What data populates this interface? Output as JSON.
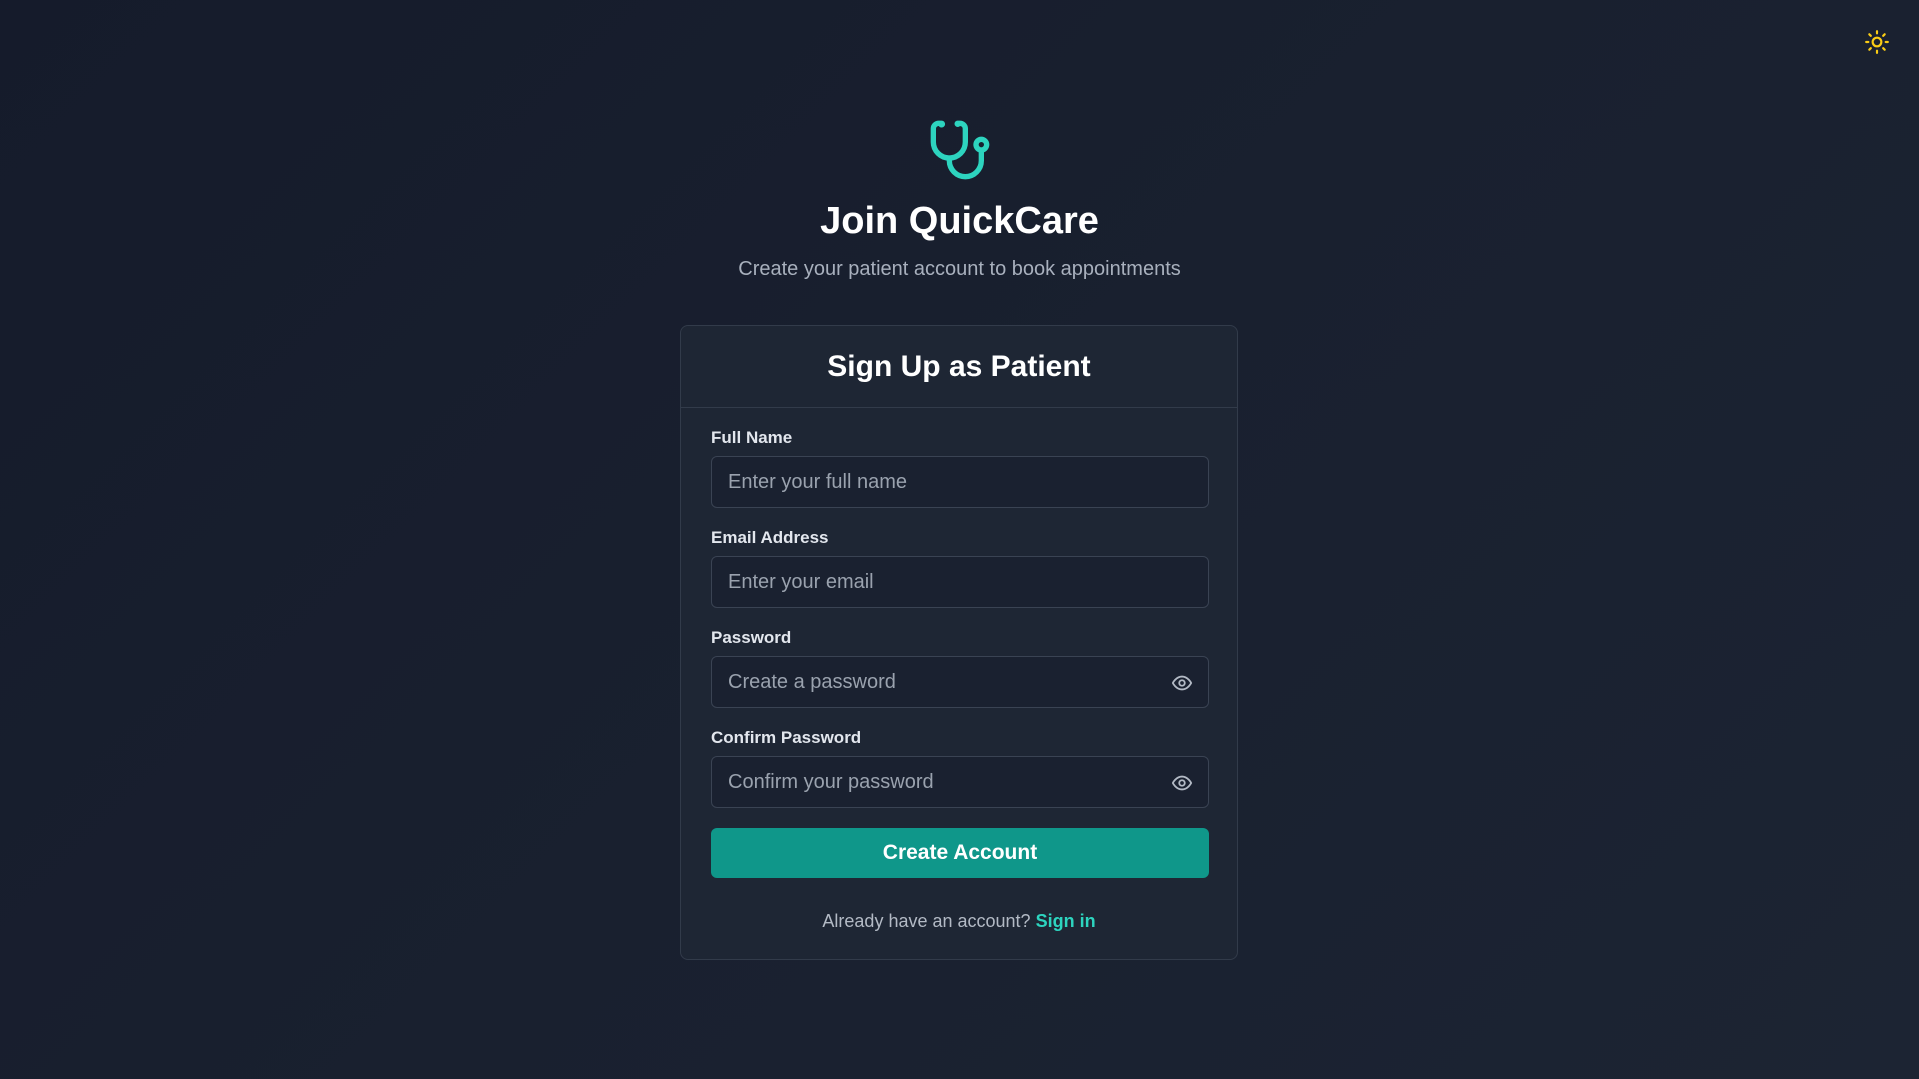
{
  "theme_toggle": {
    "icon": "sun-icon",
    "color": "#facc15"
  },
  "brand": {
    "logo_icon": "stethoscope-icon",
    "logo_color": "#2dd4bf",
    "title": "Join QuickCare",
    "subtitle": "Create your patient account to book appointments"
  },
  "form": {
    "heading": "Sign Up as Patient",
    "full_name": {
      "label": "Full Name",
      "value": "",
      "placeholder": "Enter your full name"
    },
    "email": {
      "label": "Email Address",
      "value": "",
      "placeholder": "Enter your email"
    },
    "password": {
      "label": "Password",
      "value": "",
      "placeholder": "Create a password",
      "toggle_icon": "eye-icon"
    },
    "confirm_password": {
      "label": "Confirm Password",
      "value": "",
      "placeholder": "Confirm your password",
      "toggle_icon": "eye-icon"
    },
    "submit_label": "Create Account",
    "accent_color": "#0f978a"
  },
  "footer": {
    "prompt": "Already have an account?",
    "link_label": "Sign in"
  }
}
